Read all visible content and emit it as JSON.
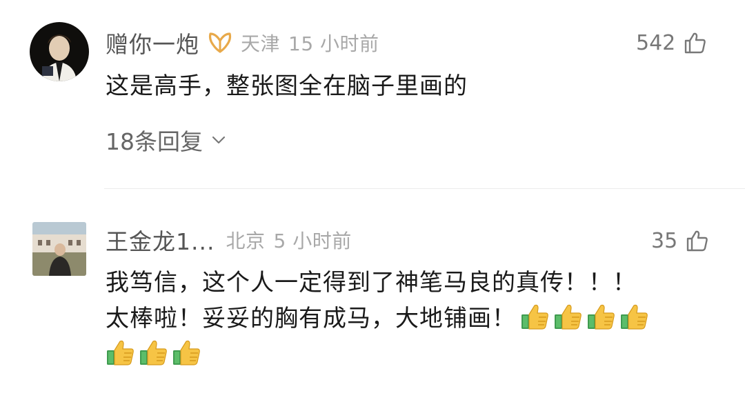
{
  "comments": [
    {
      "username": "赠你一炮",
      "badge": "vip-ribbon-icon",
      "location": "天津",
      "time": "15 小时前",
      "likes": "542",
      "text": "这是高手，整张图全在脑子里画的",
      "replies_label": "18条回复"
    },
    {
      "username": "王金龙1...",
      "location": "北京",
      "time": "5 小时前",
      "likes": "35",
      "text_line1": "我笃信，这个人一定得到了神笔马良的真传！！！",
      "text_line2": "太棒啦！妥妥的胸有成马，大地铺画！",
      "emoji": "thumbs-up-emoji",
      "emoji_count": 7
    }
  ],
  "colors": {
    "username": "#555555",
    "meta": "#a8a8a8",
    "text": "#1a1a1a",
    "badge": "#e8a94a",
    "thumb": "#f6c445"
  }
}
